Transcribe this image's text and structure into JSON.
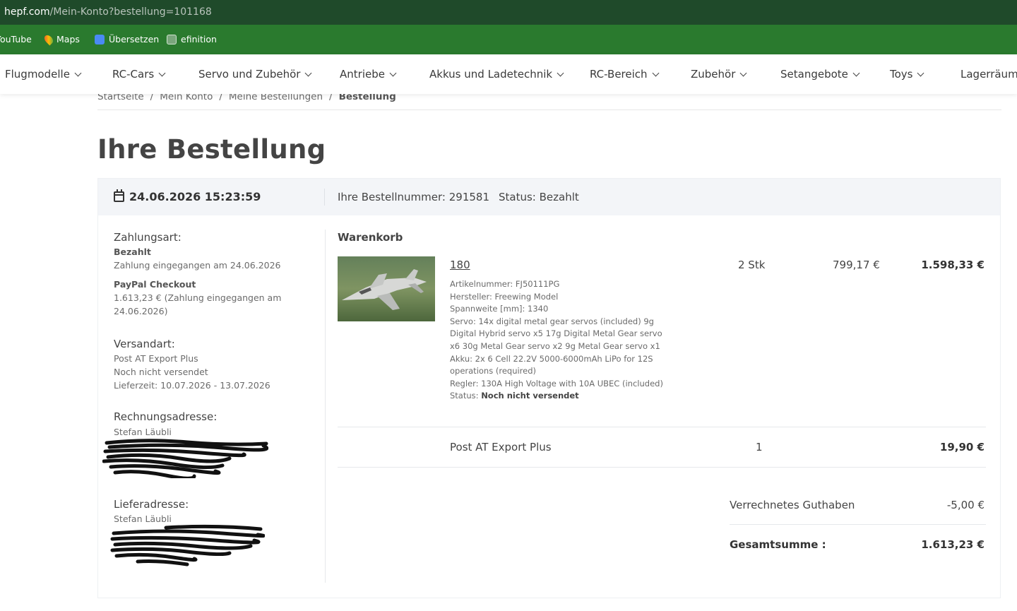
{
  "browser": {
    "url_host": "hepf.com",
    "url_path": "/Mein-Konto?bestellung=101168",
    "bookmarks": [
      {
        "label": "YouTube",
        "icon": "youtube-icon"
      },
      {
        "label": "Maps",
        "icon": "maps-icon"
      },
      {
        "label": "Übersetzen",
        "icon": "translate-icon"
      },
      {
        "label": "efinition",
        "icon": "globe-icon"
      }
    ]
  },
  "nav": {
    "items": [
      "Flugmodelle",
      "RC-Cars",
      "Servo und Zubehör",
      "Antriebe",
      "Akkus und Ladetechnik",
      "RC-Bereich",
      "Zubehör",
      "Setangebote",
      "Toys",
      "Lagerräumu"
    ]
  },
  "breadcrumb": {
    "items": [
      "Startseite",
      "Mein Konto",
      "Meine Bestellungen",
      "Bestellung"
    ],
    "separator": "/"
  },
  "page": {
    "title": "Ihre Bestellung"
  },
  "order": {
    "date": "24.06.2026 15:23:59",
    "number_text": "Ihre Bestellnummer: 291581",
    "status_text": "Status: Bezahlt"
  },
  "payment": {
    "heading": "Zahlungsart:",
    "status": "Bezahlt",
    "received": "Zahlung eingegangen am 24.06.2026",
    "method": "PayPal Checkout",
    "amount_line1": "1.613,23 € (Zahlung eingegangen am",
    "amount_line2": "24.06.2026)"
  },
  "shipping_info": {
    "heading": "Versandart:",
    "method": "Post AT Export Plus",
    "state": "Noch nicht versendet",
    "delivery": "Lieferzeit: 10.07.2026 - 13.07.2026"
  },
  "billing": {
    "heading": "Rechnungsadresse:",
    "name": "Stefan Läubli"
  },
  "delivery_address": {
    "heading": "Lieferadresse:",
    "name": "Stefan Läubli"
  },
  "cart": {
    "heading": "Warenkorb",
    "item": {
      "name": "180",
      "qty": "2 Stk",
      "unit_price": "799,17 €",
      "total": "1.598,33 €",
      "details": [
        "Artikelnummer: FJ50111PG",
        "Hersteller: Freewing Model",
        "Spannweite [mm]: 1340",
        "Servo: 14x digital metal gear servos (included) 9g",
        "Digital Hybrid servo x5 17g Digital Metal Gear servo",
        "x6 30g Metal Gear servo x2 9g Metal Gear servo x1",
        "Akku: 2x 6 Cell 22.2V 5000-6000mAh LiPo for 12S",
        "operations (required)",
        "Regler: 130A High Voltage with 10A UBEC (included)"
      ],
      "status_label": "Status:",
      "status_value": "Noch nicht versendet"
    },
    "shipping_row": {
      "name": "Post AT Export Plus",
      "qty": "1",
      "total": "19,90 €"
    },
    "credit_label": "Verrechnetes Guthaben",
    "credit_value": "-5,00 €",
    "total_label": "Gesamtsumme :",
    "total_value": "1.613,23 €"
  },
  "colors": {
    "urlbar": "#1f4a2a",
    "bookmarks_bar": "#2a7a2e",
    "order_header_bg": "#f3f5f8"
  }
}
